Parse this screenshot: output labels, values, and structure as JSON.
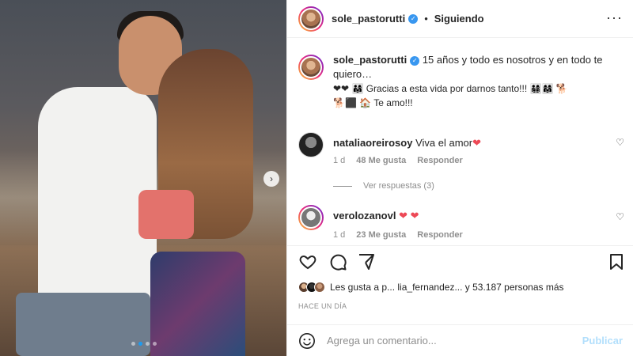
{
  "header": {
    "username": "sole_pastorutti",
    "verified_icon": "verified-badge-icon",
    "separator": "•",
    "follow_status": "Siguiendo",
    "more_icon": "more-options-icon",
    "more_glyph": "···"
  },
  "post": {
    "username": "sole_pastorutti",
    "caption_line1": "15 años y todo es nosotros y en todo te quiero…",
    "caption_line2": "❤❤ 👨‍👩‍👧 Gracias a esta vida por darnos tanto!!! 👨‍👩‍👧‍👦👩‍👩‍👧 🐕",
    "caption_line3": "🐕⬛ 🏠 Te amo!!!"
  },
  "comments": [
    {
      "username": "nataliaoreirosoy",
      "text": "Viva el amor",
      "heart": "❤",
      "time": "1 d",
      "likes": "48 Me gusta",
      "reply": "Responder"
    },
    {
      "username": "verolozanovl",
      "text": "",
      "heart": "❤ ❤",
      "time": "1 d",
      "likes": "23 Me gusta",
      "reply": "Responder"
    }
  ],
  "view_replies": "Ver respuestas (3)",
  "likes_summary": "Les gusta a p... lia_fernandez... y 53.187 personas más",
  "timestamp": "HACE UN DÍA",
  "add_comment": {
    "placeholder": "Agrega un comentario...",
    "publish": "Publicar"
  },
  "photo_nav": {
    "next_glyph": "›",
    "carousel_count": 4,
    "active_index": 1
  }
}
